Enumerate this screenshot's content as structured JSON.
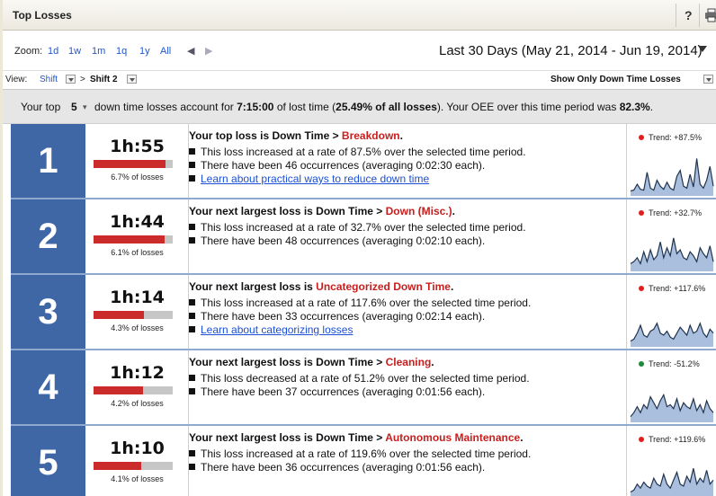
{
  "panel": {
    "title": "Top Losses",
    "help_label": "?"
  },
  "zoom": {
    "label": "Zoom:",
    "options": [
      "1d",
      "1w",
      "1m",
      "1q",
      "1y",
      "All"
    ],
    "prev_arrow": "◀",
    "next_arrow": "▶",
    "range_label": "Last 30 Days (May 21, 2014 - Jun 19, 2014)"
  },
  "view": {
    "label": "View:",
    "selector1": "Shift",
    "crumb_sep": ">",
    "selector2": "Shift 2",
    "filter_label": "Show Only Down Time Losses"
  },
  "summary": {
    "prefix": "Your top",
    "top_n": "5",
    "mid": "down time losses account for",
    "lost_time": "7:15:00",
    "mid2": "of lost time (",
    "pct_losses": "25.49% of all losses",
    "mid3": "). Your OEE over this time period was",
    "oee": "82.3%",
    "suffix": "."
  },
  "colors": {
    "rank_bg": "#3f66a5",
    "bar_red": "#cc2b2b",
    "bar_gray": "#c6c6c6",
    "category_red": "#c81e1e",
    "link_blue": "#1a4fd6",
    "trend_up": "#e02020",
    "trend_down": "#1f8a3a",
    "spark_fill": "#aabfdd",
    "spark_line": "#20344f"
  },
  "losses": [
    {
      "rank": "1",
      "time": "1h:55",
      "bar_fraction": 0.91,
      "pct_label": "6.7% of losses",
      "headline_prefix": "Your top loss is Down Time > ",
      "category": "Breakdown",
      "headline_suffix": ".",
      "lines": [
        "This loss increased at a rate of 87.5% over the selected time period.",
        "There have been 46 occurrences (averaging 0:02:30 each)."
      ],
      "link": "Learn about practical ways to reduce down time",
      "trend_label": "Trend: +87.5%",
      "trend_dir": "up",
      "spark": [
        0.08,
        0.1,
        0.25,
        0.12,
        0.1,
        0.55,
        0.15,
        0.1,
        0.35,
        0.2,
        0.12,
        0.3,
        0.15,
        0.1,
        0.45,
        0.6,
        0.2,
        0.15,
        0.5,
        0.18,
        0.9,
        0.25,
        0.15,
        0.35,
        0.7,
        0.2
      ]
    },
    {
      "rank": "2",
      "time": "1h:44",
      "bar_fraction": 0.9,
      "pct_label": "6.1% of losses",
      "headline_prefix": "Your next largest loss is Down Time > ",
      "category": "Down (Misc.)",
      "headline_suffix": ".",
      "lines": [
        "This loss increased at a rate of 32.7% over the selected time period.",
        "There have been 48 occurrences (averaging 0:02:10 each)."
      ],
      "link": "",
      "trend_label": "Trend: +32.7%",
      "trend_dir": "up",
      "spark": [
        0.15,
        0.2,
        0.3,
        0.15,
        0.45,
        0.2,
        0.5,
        0.25,
        0.35,
        0.7,
        0.3,
        0.55,
        0.35,
        0.8,
        0.4,
        0.5,
        0.3,
        0.25,
        0.45,
        0.35,
        0.2,
        0.55,
        0.4,
        0.3,
        0.6,
        0.2
      ]
    },
    {
      "rank": "3",
      "time": "1h:14",
      "bar_fraction": 0.64,
      "pct_label": "4.3% of losses",
      "headline_prefix": "Your next largest loss is ",
      "category": "Uncategorized Down Time",
      "headline_suffix": ".",
      "lines": [
        "This loss increased at a rate of 117.6% over the selected time period.",
        "There have been 33 occurrences (averaging 0:02:14 each)."
      ],
      "link": "Learn about categorizing losses",
      "trend_label": "Trend: +117.6%",
      "trend_dir": "up",
      "spark": [
        0.1,
        0.15,
        0.3,
        0.5,
        0.25,
        0.2,
        0.35,
        0.4,
        0.55,
        0.3,
        0.25,
        0.35,
        0.2,
        0.15,
        0.3,
        0.45,
        0.35,
        0.25,
        0.5,
        0.3,
        0.35,
        0.55,
        0.3,
        0.2,
        0.4,
        0.3
      ]
    },
    {
      "rank": "4",
      "time": "1h:12",
      "bar_fraction": 0.62,
      "pct_label": "4.2% of losses",
      "headline_prefix": "Your next largest loss is Down Time > ",
      "category": "Cleaning",
      "headline_suffix": ".",
      "lines": [
        "This loss decreased at a rate of 51.2% over the selected time period.",
        "There have been 37 occurrences (averaging 0:01:56 each)."
      ],
      "link": "",
      "trend_label": "Trend: -51.2%",
      "trend_dir": "down",
      "spark": [
        0.1,
        0.2,
        0.35,
        0.2,
        0.4,
        0.3,
        0.6,
        0.45,
        0.3,
        0.5,
        0.65,
        0.35,
        0.4,
        0.3,
        0.55,
        0.25,
        0.45,
        0.35,
        0.3,
        0.55,
        0.25,
        0.4,
        0.2,
        0.5,
        0.3,
        0.2
      ]
    },
    {
      "rank": "5",
      "time": "1h:10",
      "bar_fraction": 0.6,
      "pct_label": "4.1% of losses",
      "headline_prefix": "Your next largest loss is Down Time > ",
      "category": "Autonomous Maintenance",
      "headline_suffix": ".",
      "lines": [
        "This loss increased at a rate of 119.6% over the selected time period.",
        "There have been 36 occurrences (averaging 0:01:56 each)."
      ],
      "link": "",
      "trend_label": "Trend: +119.6%",
      "trend_dir": "up",
      "spark": [
        0.1,
        0.15,
        0.3,
        0.2,
        0.35,
        0.25,
        0.2,
        0.45,
        0.3,
        0.25,
        0.55,
        0.3,
        0.2,
        0.4,
        0.6,
        0.3,
        0.25,
        0.5,
        0.35,
        0.7,
        0.3,
        0.45,
        0.35,
        0.65,
        0.3,
        0.4
      ]
    }
  ]
}
